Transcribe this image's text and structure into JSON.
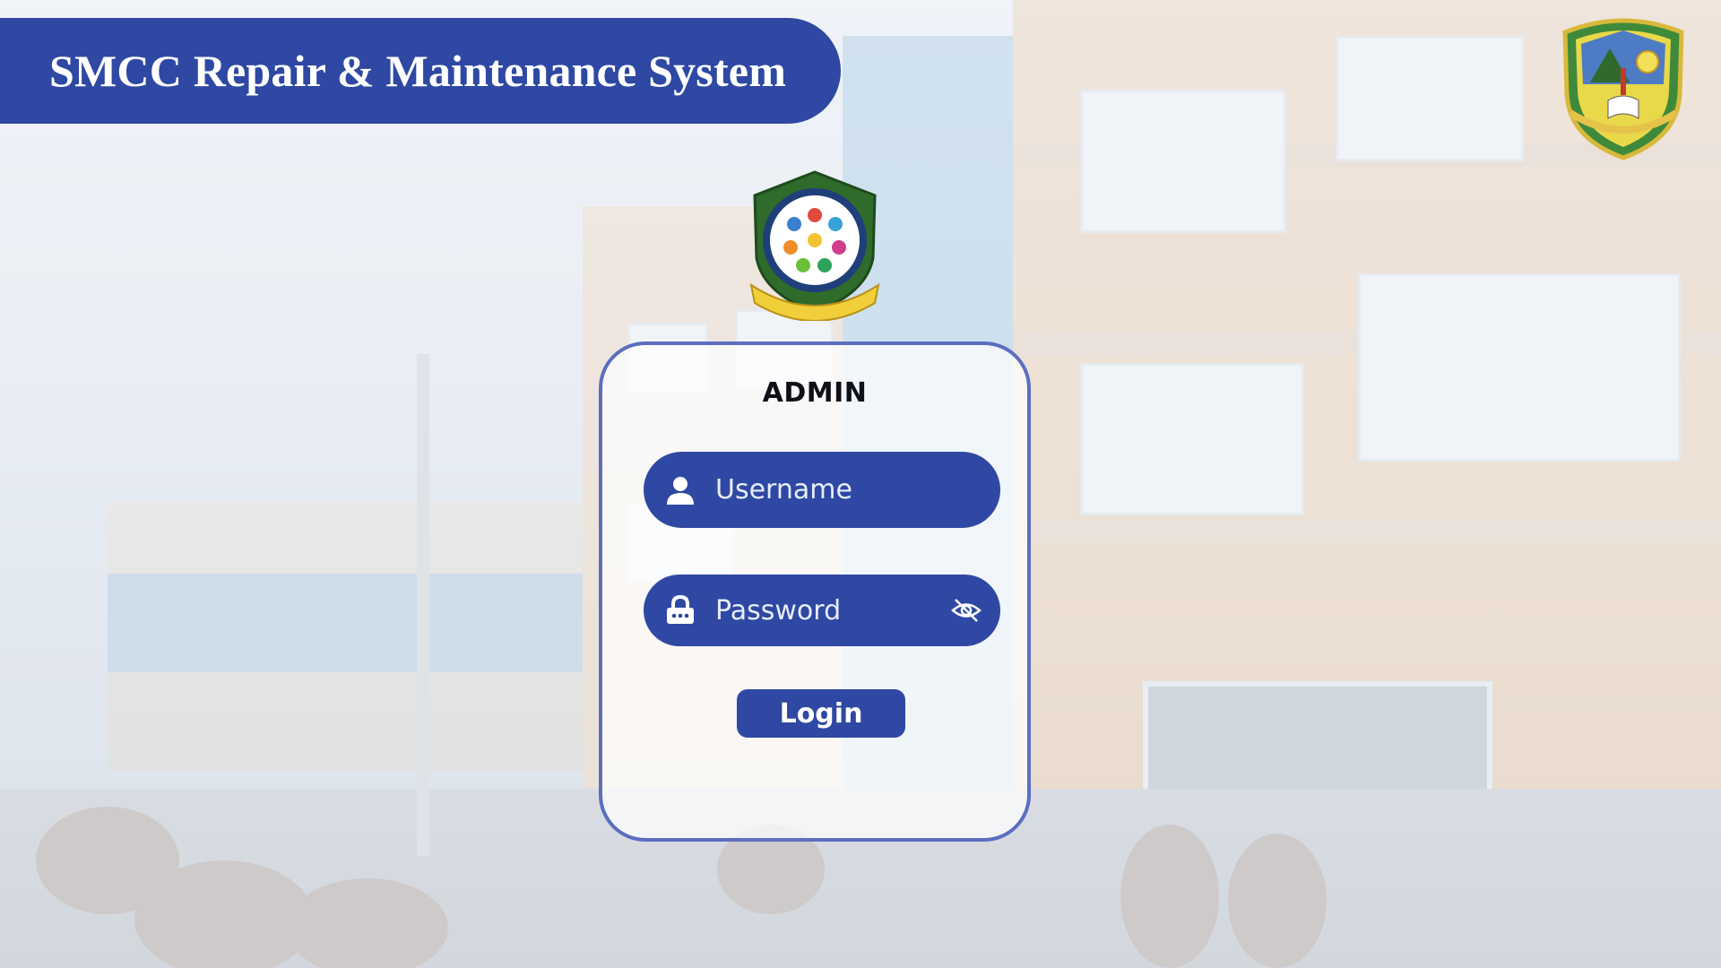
{
  "header": {
    "title": "SMCC Repair & Maintenance System"
  },
  "logos": {
    "corner": "Saint Michael College of Caraga seal",
    "center": "College of Computing and Information Sciences seal"
  },
  "login": {
    "title": "ADMIN",
    "username_placeholder": "Username",
    "password_placeholder": "Password",
    "username_value": "",
    "password_value": "",
    "button_label": "Login"
  },
  "icons": {
    "username": "user-icon",
    "password": "lock-icon",
    "toggle": "eye-slash-icon"
  },
  "colors": {
    "primary": "#2e48a3",
    "card_border": "#5b6ec0",
    "text_light": "#ffffff"
  }
}
